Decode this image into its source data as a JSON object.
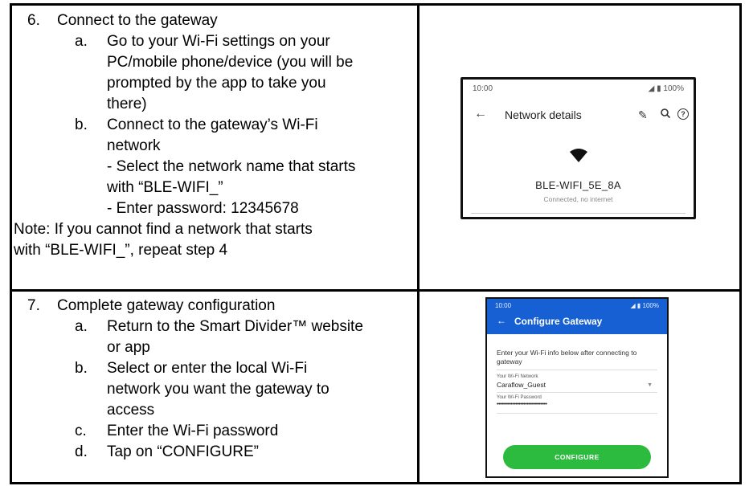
{
  "step6": {
    "number": "6.",
    "title": "Connect to the gateway",
    "a_marker": "a.",
    "a_lines": [
      "Go to your Wi-Fi settings on your",
      "PC/mobile phone/device (you will be",
      "prompted by the app to take you",
      "there)"
    ],
    "b_marker": "b.",
    "b_lines": [
      "Connect to the gateway’s Wi-Fi",
      "network",
      "- Select the network name that starts",
      "with “BLE-WIFI_”",
      "- Enter password: 12345678"
    ],
    "note_lines": [
      "Note:  If you cannot find a network that starts",
      "with “BLE-WIFI_”, repeat step 4"
    ]
  },
  "step7": {
    "number": "7.",
    "title": "Complete gateway configuration",
    "a_marker": "a.",
    "a_lines": [
      "Return to the Smart Divider™ website",
      "or app"
    ],
    "b_marker": "b.",
    "b_lines": [
      "Select or enter the local Wi-Fi",
      "network you want the gateway to",
      "access"
    ],
    "c_marker": "c.",
    "c_lines": [
      "Enter the Wi-Fi password"
    ],
    "d_marker": "d.",
    "d_lines": [
      "Tap on “CONFIGURE”"
    ]
  },
  "phone1": {
    "time": "10:00",
    "battery": "100%",
    "back_icon": "arrow-left-icon",
    "title": "Network details",
    "network_name": "BLE-WIFI_5E_8A",
    "status": "Connected, no internet"
  },
  "phone2": {
    "time": "10:00",
    "battery": "100%",
    "title": "Configure Gateway",
    "intro": "Enter your Wi-Fi info below after connecting to gateway",
    "network_label": "Your Wi-Fi Network",
    "network_value": "Caraflow_Guest",
    "password_label": "Your Wi-Fi Password",
    "password_value": "••••••••••••••••••••••••••••••••",
    "button_label": "CONFIGURE",
    "colors": {
      "header": "#1660d4",
      "button": "#2dbb3f"
    }
  }
}
